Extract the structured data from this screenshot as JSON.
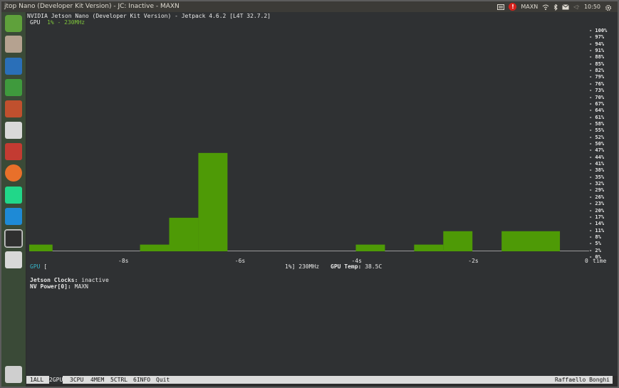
{
  "window": {
    "title": "jtop Nano (Developer Kit Version) - JC: Inactive - MAXN"
  },
  "tray": {
    "power_mode": "MAXN",
    "power_badge": "!",
    "volume": "◁·",
    "time": "10:50",
    "icons": [
      "keyboard-icon",
      "alert-icon",
      "wifi-icon",
      "bluetooth-icon",
      "mail-icon",
      "volume-icon",
      "gear-icon"
    ]
  },
  "launcher": {
    "items": [
      {
        "name": "ubuntu-dash-icon",
        "color": "#5fa13b"
      },
      {
        "name": "files-icon",
        "color": "#b5a290"
      },
      {
        "name": "writer-icon",
        "color": "#2a6fb8"
      },
      {
        "name": "calc-icon",
        "color": "#3f9a3d"
      },
      {
        "name": "impress-icon",
        "color": "#c0502e"
      },
      {
        "name": "software-center-icon",
        "color": "#d9d9d9"
      },
      {
        "name": "system-settings-icon",
        "color": "#c33b32"
      },
      {
        "name": "firefox-icon",
        "color": "#e8702a"
      },
      {
        "name": "pycharm-icon",
        "color": "#21d789"
      },
      {
        "name": "vscode-icon",
        "color": "#1e8ad6"
      },
      {
        "name": "terminal-icon",
        "color": "#2f2f2f"
      },
      {
        "name": "drive-icon",
        "color": "#d8d8d8"
      },
      {
        "name": "trash-icon",
        "color": "#cfcfcf"
      }
    ]
  },
  "header": {
    "board": "NVIDIA Jetson Nano (Developer Kit Version) - Jetpack 4.6.2 [L4T 32.7.2]",
    "gpu_label": "GPU",
    "gpu_value": "1% - 230MHz"
  },
  "chart_data": {
    "type": "bar",
    "title": "GPU  1% - 230MHz",
    "xlabel": "time",
    "ylabel": "",
    "ylim": [
      0,
      100
    ],
    "x_ticks": [
      "-8s",
      "-6s",
      "-4s",
      "-2s",
      "0"
    ],
    "y_ticks": [
      "100%",
      "97%",
      "94%",
      "91%",
      "88%",
      "85%",
      "82%",
      "79%",
      "76%",
      "73%",
      "70%",
      "67%",
      "64%",
      "61%",
      "58%",
      "55%",
      "52%",
      "50%",
      "47%",
      "44%",
      "41%",
      "38%",
      "35%",
      "32%",
      "29%",
      "26%",
      "23%",
      "20%",
      "17%",
      "14%",
      "11%",
      "8%",
      "5%",
      "2%",
      "0%"
    ],
    "bars": [
      {
        "x_start": -9.6,
        "x_end": -9.2,
        "value": 3
      },
      {
        "x_start": -7.7,
        "x_end": -7.2,
        "value": 3
      },
      {
        "x_start": -7.2,
        "x_end": -6.7,
        "value": 15
      },
      {
        "x_start": -6.7,
        "x_end": -6.2,
        "value": 44
      },
      {
        "x_start": -4.0,
        "x_end": -3.5,
        "value": 3
      },
      {
        "x_start": -3.0,
        "x_end": -2.5,
        "value": 3
      },
      {
        "x_start": -2.5,
        "x_end": -2.0,
        "value": 9
      },
      {
        "x_start": -1.5,
        "x_end": -0.5,
        "value": 9
      }
    ],
    "bar_color": "#4e9a06",
    "grid": false
  },
  "gpu_bar": {
    "label": "GPU",
    "open": "[",
    "close_text": "1%] 230MHz",
    "temp_label": "GPU Temp:",
    "temp_value": "38.5C"
  },
  "info": {
    "clocks_label": "Jetson Clocks:",
    "clocks_value": "inactive",
    "power_label": "NV Power[0]:",
    "power_value": "MAXN"
  },
  "menu": {
    "items": [
      {
        "num": "1",
        "label": "ALL"
      },
      {
        "num": "2",
        "label": "GPU"
      },
      {
        "num": "3",
        "label": "CPU"
      },
      {
        "num": "4",
        "label": "MEM"
      },
      {
        "num": "5",
        "label": "CTRL"
      },
      {
        "num": "6",
        "label": "INFO"
      }
    ],
    "quit": "Quit",
    "author": "Raffaello Bonghi"
  }
}
